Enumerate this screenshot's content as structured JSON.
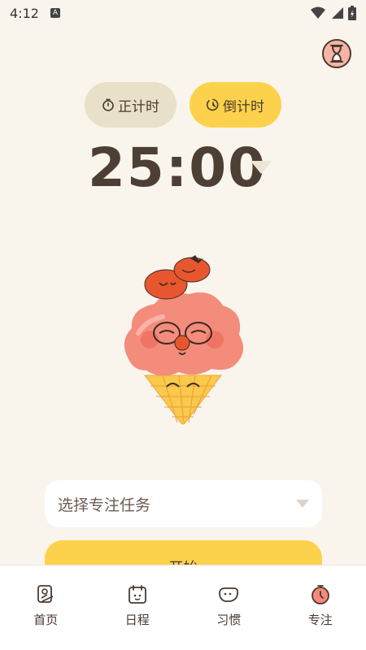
{
  "status_bar": {
    "time": "4:12",
    "a_badge": "A"
  },
  "top_right": {
    "icon": "hourglass-icon",
    "accent": "#f6b4a4"
  },
  "mode_toggle": {
    "countup_label": "正计时",
    "countdown_label": "倒计时",
    "active": "countdown"
  },
  "timer": {
    "value": "25:00"
  },
  "task_select": {
    "placeholder": "选择专注任务"
  },
  "start_button": {
    "label": "开始"
  },
  "bottom_nav": {
    "items": [
      {
        "label": "首页",
        "icon": "home-icon"
      },
      {
        "label": "日程",
        "icon": "calendar-icon"
      },
      {
        "label": "习惯",
        "icon": "habit-icon"
      },
      {
        "label": "专注",
        "icon": "focus-timer-icon"
      }
    ],
    "active": "专注"
  },
  "colors": {
    "accent": "#fcd24c",
    "background": "#f9f5ec",
    "mascot_primary": "#f58a7c"
  }
}
